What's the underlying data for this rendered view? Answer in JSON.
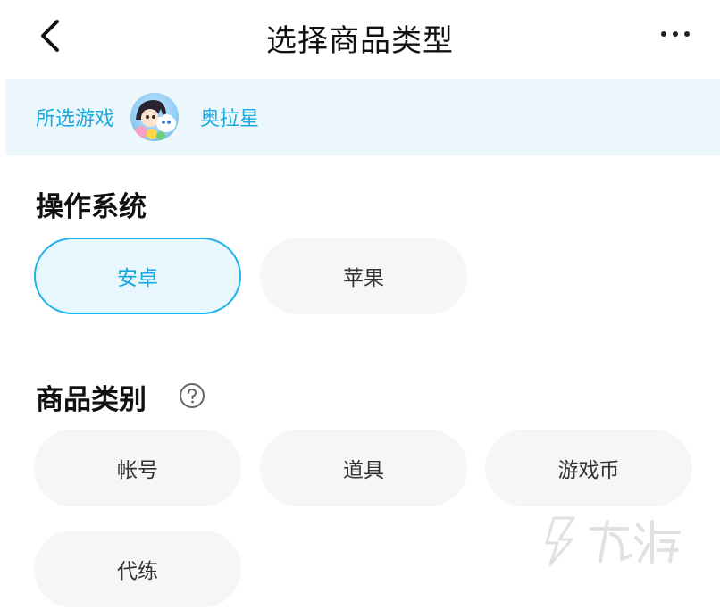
{
  "header": {
    "title": "选择商品类型",
    "back_icon": "chevron-left-icon",
    "more_icon": "more-horizontal-icon"
  },
  "game_bar": {
    "label": "所选游戏",
    "game_name": "奥拉星",
    "background": "#edf8fd",
    "text_color": "#1aa9e0"
  },
  "os_section": {
    "title": "操作系统",
    "options": [
      {
        "label": "安卓",
        "selected": true
      },
      {
        "label": "苹果",
        "selected": false
      }
    ]
  },
  "category_section": {
    "title": "商品类别",
    "help_icon": "question-circle-icon",
    "options": [
      {
        "label": "帐号"
      },
      {
        "label": "道具"
      },
      {
        "label": "游戏币"
      },
      {
        "label": "代练"
      }
    ]
  },
  "colors": {
    "accent": "#1fb2ea",
    "chip_bg": "#f5f6f8",
    "selected_bg": "#e8f7fd"
  }
}
